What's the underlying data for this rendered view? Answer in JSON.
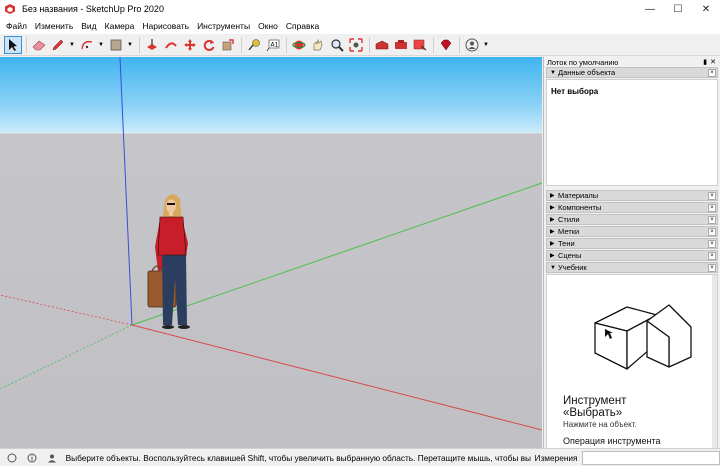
{
  "window": {
    "title": "Без названия - SketchUp Pro 2020",
    "app_icon": "sketchup-icon"
  },
  "menu": [
    "Файл",
    "Изменить",
    "Вид",
    "Камера",
    "Нарисовать",
    "Инструменты",
    "Окно",
    "Справка"
  ],
  "toolbar": {
    "tools": [
      "select-icon",
      "eraser-icon",
      "pencil-icon",
      "arc-icon",
      "rectangle-icon",
      "push-pull-icon",
      "follow-me-icon",
      "move-icon",
      "rotate-icon",
      "scale-icon",
      "tape-measure-icon",
      "text-icon",
      "orbit-icon",
      "pan-icon",
      "zoom-icon",
      "zoom-extents-icon",
      "warehouse-icon",
      "extension-warehouse-icon",
      "send-to-layout-icon",
      "ruby-icon",
      "account-icon"
    ]
  },
  "colors": {
    "sky_top": "#3fb4ef",
    "ground": "#c0c0c4",
    "axis_blue": "#3b4cd8",
    "axis_green": "#4bbf4b",
    "axis_red": "#d84a4a",
    "selected_tool": "#cce4f7"
  },
  "tray": {
    "title": "Лоток по умолчанию",
    "entity_info": {
      "label": "Данные объекта",
      "content": "Нет выбора"
    },
    "panels": [
      "Материалы",
      "Компоненты",
      "Стили",
      "Метки",
      "Тени",
      "Сцены"
    ],
    "instructor": {
      "label": "Учебник",
      "title_line1": "Инструмент",
      "title_line2": "«Выбрать»",
      "subtitle": "Нажмите на объект.",
      "operation": "Операция инструмента"
    }
  },
  "status": {
    "hint": "Выберите объекты. Воспользуйтесь клавишей Shift, чтобы увеличить выбранную область. Перетащите мышь, чтобы выбрать",
    "measure_label": "Измерения",
    "measure_value": ""
  }
}
